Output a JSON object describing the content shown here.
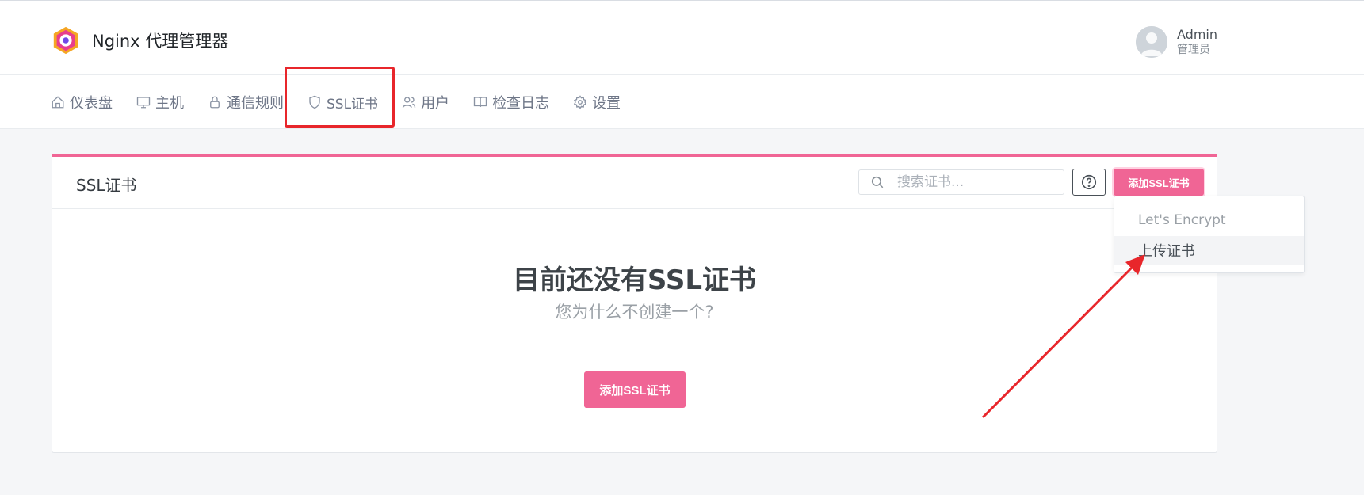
{
  "header": {
    "brand_title": "Nginx 代理管理器",
    "user_name": "Admin",
    "user_role": "管理员"
  },
  "nav": {
    "items": [
      {
        "label": "仪表盘",
        "icon": "home-icon"
      },
      {
        "label": "主机",
        "icon": "monitor-icon"
      },
      {
        "label": "通信规则",
        "icon": "lock-icon"
      },
      {
        "label": "SSL证书",
        "icon": "shield-icon"
      },
      {
        "label": "用户",
        "icon": "users-icon"
      },
      {
        "label": "检查日志",
        "icon": "book-icon"
      },
      {
        "label": "设置",
        "icon": "gear-icon"
      }
    ]
  },
  "card": {
    "title": "SSL证书",
    "search_placeholder": "搜索证书...",
    "add_button_label": "添加SSL证书",
    "empty_title": "目前还没有SSL证书",
    "empty_subtitle": "您为什么不创建一个?",
    "empty_button_label": "添加SSL证书"
  },
  "dropdown": {
    "items": [
      {
        "label": "Let's Encrypt"
      },
      {
        "label": "上传证书"
      }
    ]
  },
  "colors": {
    "accent": "#f06595",
    "annotation": "#e8262b"
  }
}
